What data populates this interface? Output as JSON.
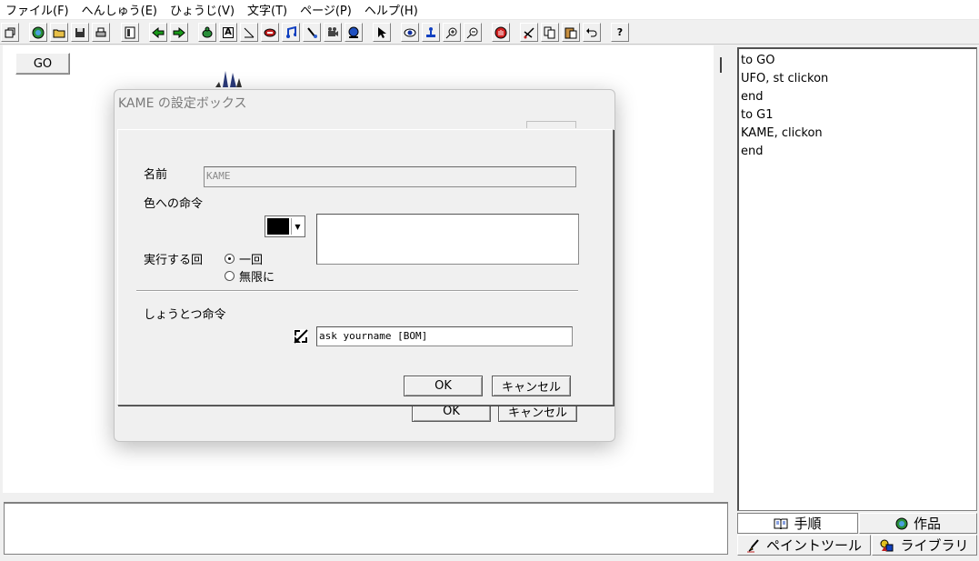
{
  "menu": {
    "items": [
      {
        "label": "ファイル(F)"
      },
      {
        "label": "へんしゅう(E)"
      },
      {
        "label": "ひょうじ(V)"
      },
      {
        "label": "文字(T)"
      },
      {
        "label": "ページ(P)"
      },
      {
        "label": "ヘルプ(H)"
      }
    ]
  },
  "toolbar": {
    "help_label": "?",
    "text_tool_label": "A"
  },
  "canvas": {
    "go_button_label": "GO"
  },
  "script": {
    "lines": [
      "to GO",
      "UFO, st clickon",
      "end",
      "to G1",
      "KAME, clickon",
      "end"
    ]
  },
  "tabs": {
    "steps": "手順",
    "works": "作品",
    "paint_tool": "ペイントツール",
    "library": "ライブラリ"
  },
  "dialog": {
    "title": "KAME の設定ボックス",
    "name_label": "名前",
    "name_value": "KAME",
    "color_command_label": "色への命令",
    "selected_color": "#000000",
    "exec_label": "実行する回",
    "exec_options": {
      "once": "一回",
      "infinite": "無限に"
    },
    "exec_selected": "once",
    "collision_label": "しょうとつ命令",
    "collision_command": "ask yourname [BOM]",
    "ok_label": "OK",
    "cancel_label": "キャンセル"
  },
  "ghost_dialog": {
    "ok_label": "OK",
    "cancel_label": "キャンセル"
  }
}
